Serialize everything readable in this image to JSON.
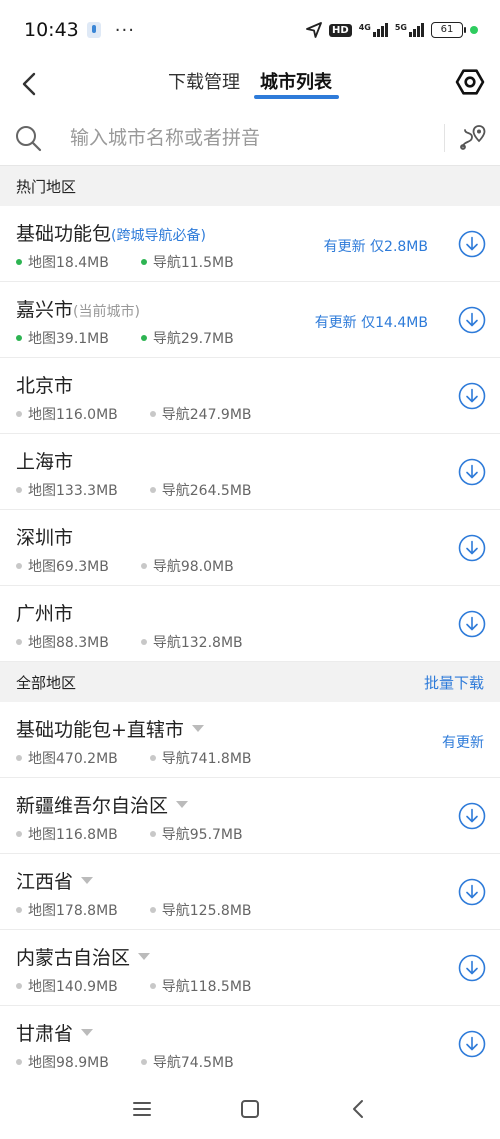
{
  "status_bar": {
    "time": "10:43",
    "dots": "···",
    "hd_label": "HD",
    "net1_label": "4G",
    "net2_label": "5G",
    "battery": "61"
  },
  "header": {
    "tab_download": "下载管理",
    "tab_city": "城市列表"
  },
  "search": {
    "placeholder": "输入城市名称或者拼音"
  },
  "hot_section": {
    "title": "热门地区"
  },
  "hot_rows": [
    {
      "name": "基础功能包",
      "tag": "(跨城导航必备)",
      "map": "地图18.4MB",
      "nav": "导航11.5MB",
      "status": "有更新  仅2.8MB"
    },
    {
      "name": "嘉兴市",
      "tag": "(当前城市)",
      "map": "地图39.1MB",
      "nav": "导航29.7MB",
      "status": "有更新  仅14.4MB"
    },
    {
      "name": "北京市",
      "map": "地图116.0MB",
      "nav": "导航247.9MB"
    },
    {
      "name": "上海市",
      "map": "地图133.3MB",
      "nav": "导航264.5MB"
    },
    {
      "name": "深圳市",
      "map": "地图69.3MB",
      "nav": "导航98.0MB"
    },
    {
      "name": "广州市",
      "map": "地图88.3MB",
      "nav": "导航132.8MB"
    }
  ],
  "all_section": {
    "title": "全部地区",
    "action": "批量下载"
  },
  "all_rows": [
    {
      "name": "基础功能包+直辖市",
      "map": "地图470.2MB",
      "nav": "导航741.8MB",
      "status": "有更新"
    },
    {
      "name": "新疆维吾尔自治区",
      "map": "地图116.8MB",
      "nav": "导航95.7MB"
    },
    {
      "name": "江西省",
      "map": "地图178.8MB",
      "nav": "导航125.8MB"
    },
    {
      "name": "内蒙古自治区",
      "map": "地图140.9MB",
      "nav": "导航118.5MB"
    },
    {
      "name": "甘肃省",
      "map": "地图98.9MB",
      "nav": "导航74.5MB"
    }
  ],
  "colors": {
    "accent": "#2e7bd9",
    "downloaded_dot": "#2db452",
    "pending_dot": "#c8c8c8"
  }
}
